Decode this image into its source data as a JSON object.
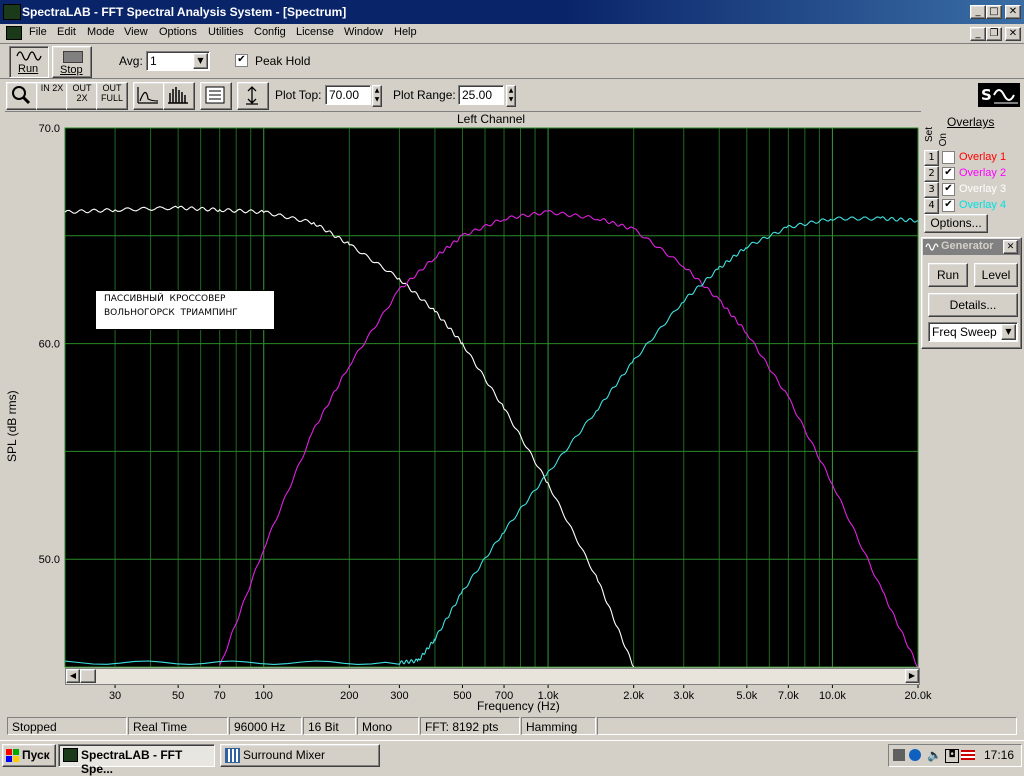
{
  "window": {
    "title": "SpectraLAB - FFT Spectral Analysis System - [Spectrum]"
  },
  "menu": [
    "File",
    "Edit",
    "Mode",
    "View",
    "Options",
    "Utilities",
    "Config",
    "License",
    "Window",
    "Help"
  ],
  "toolbar1": {
    "run_label": "Run",
    "stop_label": "Stop",
    "avg_label": "Avg:",
    "avg_value": "1",
    "peak_hold_label": "Peak Hold",
    "peak_hold_checked": true
  },
  "toolbar2": {
    "plot_top_label": "Plot Top:",
    "plot_top_value": "70.00",
    "plot_range_label": "Plot Range:",
    "plot_range_value": "25.00",
    "zoom_buttons": [
      "IN 2X",
      "OUT 2X",
      "OUT FULL"
    ]
  },
  "chart_data": {
    "type": "line",
    "title": "Left Channel",
    "xlabel": "Frequency (Hz)",
    "ylabel": "SPL (dB rms)",
    "xscale": "log",
    "xlim": [
      20,
      20000
    ],
    "ylim": [
      45,
      70
    ],
    "ytick_labels": [
      "70.0",
      "60.0",
      "50.0"
    ],
    "ytick_values": [
      70,
      60,
      50
    ],
    "xtick_labels": [
      "30",
      "50",
      "70",
      "100",
      "200",
      "300",
      "500",
      "700",
      "1.0k",
      "2.0k",
      "3.0k",
      "5.0k",
      "7.0k",
      "10.0k",
      "20.0k"
    ],
    "xtick_values": [
      30,
      50,
      70,
      100,
      200,
      300,
      500,
      700,
      1000,
      2000,
      3000,
      5000,
      7000,
      10000,
      20000
    ],
    "annotation": [
      "ПАССИВНЫЙ  КРОССОВЕР",
      "ВОЛЬНОГОРСК  ТРИАМПИНГ"
    ],
    "series": [
      {
        "color": "#ffffff",
        "x": [
          20,
          30,
          50,
          70,
          100,
          150,
          200,
          300,
          400,
          500,
          700,
          1000,
          1500,
          2000
        ],
        "y": [
          66.1,
          66.2,
          66.3,
          66.2,
          66.1,
          65.6,
          64.6,
          63.0,
          61.5,
          60.0,
          57.0,
          53.5,
          49.0,
          45.0
        ]
      },
      {
        "color": "#e020e0",
        "x": [
          70,
          100,
          150,
          200,
          300,
          400,
          500,
          700,
          1000,
          1500,
          2000,
          3000,
          4000,
          5000,
          7000,
          10000,
          15000,
          20000
        ],
        "y": [
          45.0,
          50.5,
          56.0,
          59.0,
          62.5,
          64.0,
          65.0,
          65.8,
          66.1,
          65.8,
          65.3,
          63.6,
          62.0,
          60.5,
          57.5,
          53.5,
          48.5,
          45.0
        ]
      },
      {
        "color": "#40e0e0",
        "x": [
          20,
          300,
          350,
          400,
          500,
          700,
          1000,
          1500,
          2000,
          3000,
          4000,
          5000,
          7000,
          10000,
          15000,
          20000
        ],
        "y": [
          45.2,
          45.2,
          45.3,
          46.3,
          48.5,
          51.3,
          54.0,
          57.0,
          59.2,
          62.0,
          63.5,
          64.5,
          65.4,
          65.8,
          65.8,
          65.7
        ]
      }
    ]
  },
  "overlays": {
    "header": "Overlays",
    "set_col": "Set",
    "on_col": "On",
    "items": [
      {
        "num": "1",
        "label": "Overlay 1",
        "checked": false,
        "color": "#ff0000"
      },
      {
        "num": "2",
        "label": "Overlay 2",
        "checked": true,
        "color": "#ff00ff"
      },
      {
        "num": "3",
        "label": "Overlay 3",
        "checked": true,
        "color": "#ffffff"
      },
      {
        "num": "4",
        "label": "Overlay 4",
        "checked": true,
        "color": "#00e0e0"
      }
    ],
    "options_label": "Options..."
  },
  "generator": {
    "title": "Generator",
    "run_label": "Run",
    "level_label": "Level",
    "details_label": "Details...",
    "mode_value": "Freq Sweep"
  },
  "status": [
    "Stopped",
    "Real Time",
    "96000 Hz",
    "16 Bit",
    "Mono",
    "FFT: 8192 pts",
    "Hamming"
  ],
  "taskbar": {
    "start_label": "Пуск",
    "tasks": [
      "SpectraLAB - FFT Spe...",
      "Surround Mixer"
    ],
    "clock": "17:16"
  }
}
